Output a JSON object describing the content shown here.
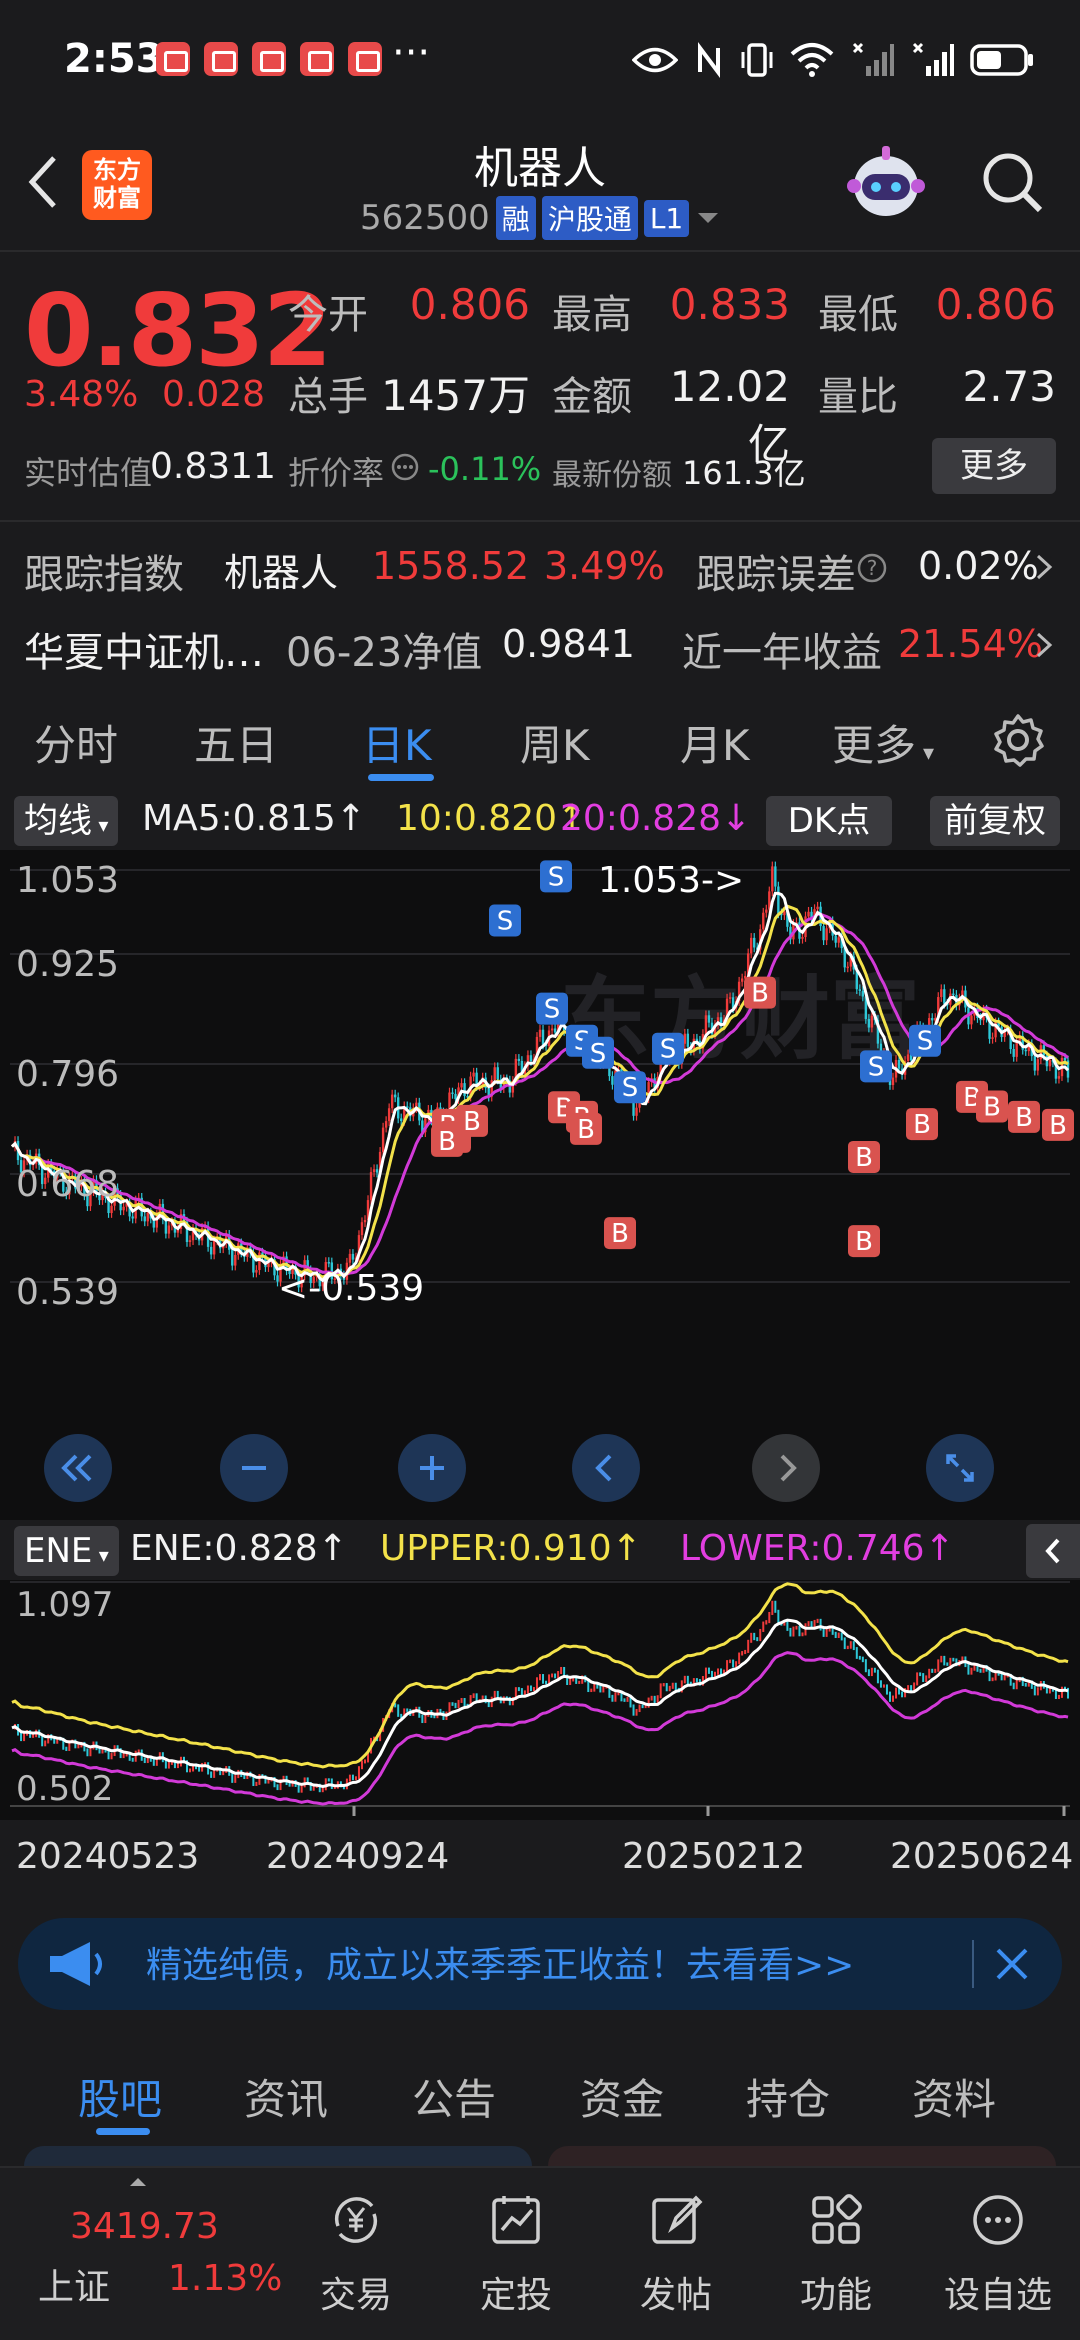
{
  "status_bar": {
    "time": "2:53",
    "dots": "···"
  },
  "header": {
    "logo_text_1": "东方",
    "logo_text_2": "财富",
    "title": "机器人",
    "code": "562500",
    "tags": [
      "融",
      "沪股通",
      "L1"
    ]
  },
  "quote": {
    "price": "0.832",
    "change_pct": "3.48%",
    "change_abs": "0.028",
    "open_label": "今开",
    "open": "0.806",
    "high_label": "最高",
    "high": "0.833",
    "low_label": "最低",
    "low": "0.806",
    "volume_label": "总手",
    "volume": "1457万",
    "amount_label": "金额",
    "amount": "12.02亿",
    "ratio_label": "量比",
    "ratio": "2.73",
    "iopv_label": "实时估值",
    "iopv": "0.8311",
    "discount_label": "折价率",
    "discount": "-0.11%",
    "shares_label": "最新份额",
    "shares": "161.3亿",
    "more_label": "更多",
    "track_label": "跟踪指数",
    "track_name": "机器人",
    "track_value": "1558.52",
    "track_pct": "3.49%",
    "error_label": "跟踪误差",
    "error_value": "0.02%",
    "fund_name": "华夏中证机…",
    "nav_label": "06-23净值",
    "nav_value": "0.9841",
    "year_label": "近一年收益",
    "year_value": "21.54%"
  },
  "tabs": [
    "分时",
    "五日",
    "日K",
    "周K",
    "月K",
    "更多"
  ],
  "active_tab": "日K",
  "kline": {
    "ma_selector": "均线",
    "ma5": "MA5:0.815↑",
    "ma10": "10:0.820↑",
    "ma20": "20:0.828↓",
    "dk_label": "DK点",
    "fq_label": "前复权",
    "y_labels": [
      "1.053",
      "0.925",
      "0.796",
      "0.668",
      "0.539"
    ],
    "max_marker": "1.053->",
    "min_marker": "<-0.539",
    "ene_selector": "ENE",
    "ene": "ENE:0.828↑",
    "upper": "UPPER:0.910↑",
    "lower": "LOWER:0.746↑",
    "ene_y_labels": [
      "1.097",
      "0.502"
    ],
    "dates": [
      "20240523",
      "20240924",
      "20250212",
      "20250624"
    ],
    "colors": {
      "up": "#f03b3b",
      "down": "#2ec8d8",
      "ma5": "#ffffff",
      "ma10": "#f3e24a",
      "ma20": "#d23ad8"
    }
  },
  "ad": {
    "text": "精选纯债，成立以来季季正收益！去看看>>"
  },
  "bottom_tabs": [
    "股吧",
    "资讯",
    "公告",
    "资金",
    "持仓",
    "资料"
  ],
  "active_bottom_tab": "股吧",
  "nav": {
    "index_value": "3419.73",
    "index_name": "上证",
    "index_pct": "1.13%",
    "items": [
      "交易",
      "定投",
      "发帖",
      "功能",
      "设自选"
    ]
  }
}
